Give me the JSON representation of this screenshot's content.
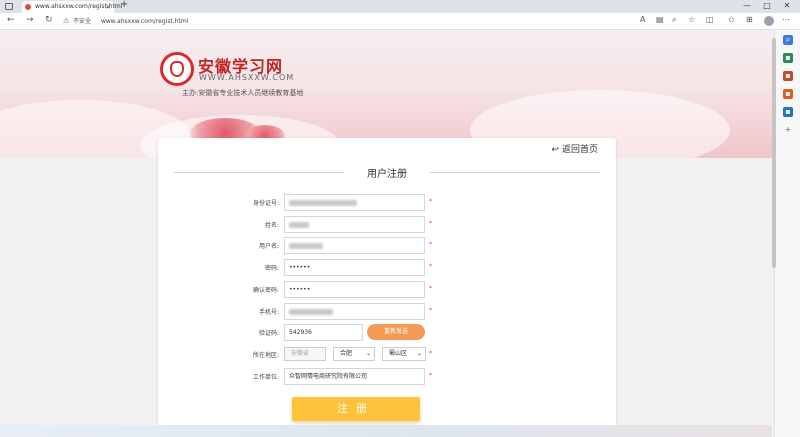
{
  "browser": {
    "tab_title": "www.ahsxxw.com/regist.html",
    "tab_close": "×",
    "new_tab": "+",
    "nav": {
      "back": "←",
      "forward": "→",
      "refresh": "↻"
    },
    "insecure_label": "不安全",
    "url": "www.ahsxxw.com/regist.html",
    "window_controls": [
      "—",
      "□",
      "✕"
    ]
  },
  "header": {
    "site_name": "安徽学习网",
    "site_url": "WWW.AHSXXW.COM",
    "subtitle": "主办:安徽省专业技术人员继续教育基地"
  },
  "card": {
    "back_home": "返回首页",
    "title": "用户注册",
    "fields": {
      "id_number": {
        "label": "身份证号:"
      },
      "name": {
        "label": "姓名:"
      },
      "username": {
        "label": "用户名:"
      },
      "password": {
        "label": "密码:",
        "value": "••••••"
      },
      "confirm_password": {
        "label": "确认密码:",
        "value": "••••••"
      },
      "phone": {
        "label": "手机号:"
      },
      "code": {
        "label": "验证码:",
        "value": "542936",
        "resend": "重新发送"
      },
      "region": {
        "label": "所在地区:",
        "province": "安徽省",
        "city": "合肥",
        "district": "蜀山区"
      },
      "company": {
        "label": "工作单位:",
        "value": "众智网情电商研究院有限公司"
      }
    },
    "required_mark": "*",
    "submit": "注册"
  }
}
